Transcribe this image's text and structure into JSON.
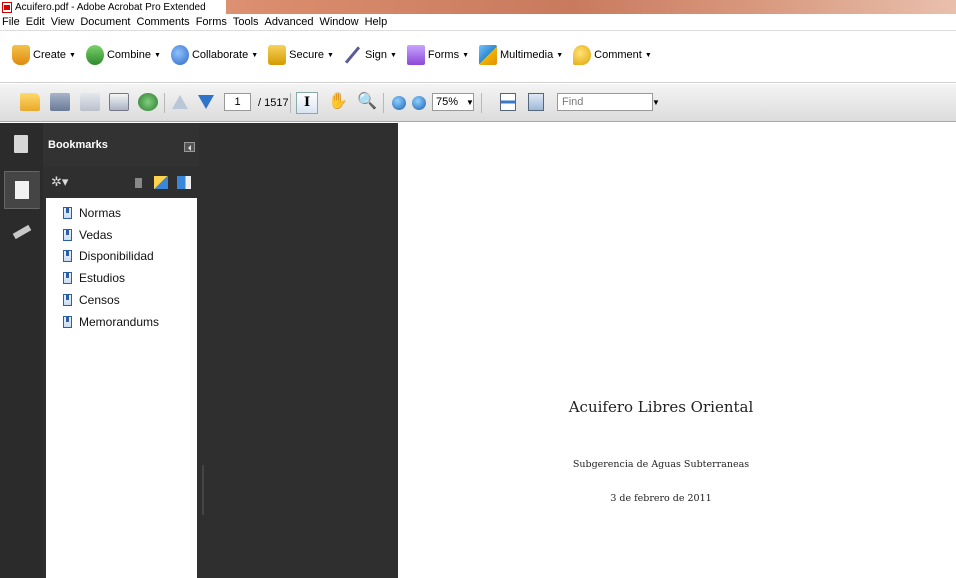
{
  "window": {
    "title": "Acuifero.pdf - Adobe Acrobat Pro Extended"
  },
  "menu": [
    "File",
    "Edit",
    "View",
    "Document",
    "Comments",
    "Forms",
    "Tools",
    "Advanced",
    "Window",
    "Help"
  ],
  "tasks": [
    {
      "label": "Create",
      "icon": "create-icon"
    },
    {
      "label": "Combine",
      "icon": "combine-icon"
    },
    {
      "label": "Collaborate",
      "icon": "collaborate-icon"
    },
    {
      "label": "Secure",
      "icon": "lock-icon"
    },
    {
      "label": "Sign",
      "icon": "pen-icon"
    },
    {
      "label": "Forms",
      "icon": "form-icon"
    },
    {
      "label": "Multimedia",
      "icon": "multimedia-icon"
    },
    {
      "label": "Comment",
      "icon": "comment-icon"
    }
  ],
  "nav": {
    "current_page": "1",
    "page_count": "/ 1517",
    "zoom": "75%",
    "find_placeholder": "Find"
  },
  "bookmarks": {
    "title": "Bookmarks",
    "items": [
      "Normas",
      "Vedas",
      "Disponibilidad",
      "Estudios",
      "Censos",
      "Memorandums"
    ]
  },
  "document": {
    "title": "Acuifero Libres Oriental",
    "subtitle": "Subgerencia de Aguas Subterraneas",
    "date": "3 de febrero de 2011"
  }
}
